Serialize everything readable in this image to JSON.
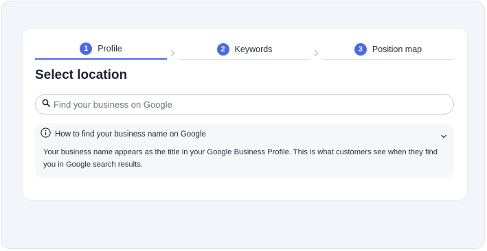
{
  "stepper": {
    "steps": [
      {
        "number": "1",
        "label": "Profile",
        "active": true
      },
      {
        "number": "2",
        "label": "Keywords",
        "active": false
      },
      {
        "number": "3",
        "label": "Position map",
        "active": false
      }
    ]
  },
  "page": {
    "title": "Select location"
  },
  "search": {
    "placeholder": "Find your business on Google",
    "value": ""
  },
  "help": {
    "title": "How to find your business name on Google",
    "body": "Your business name appears as the title in your Google Business Profile. This is what customers see when they find you in Google search results.",
    "expanded": true
  },
  "icons": {
    "step_separator": "chevron-right-icon",
    "search": "search-icon",
    "info": "info-icon",
    "collapse": "chevron-down-icon"
  },
  "colors": {
    "accent": "#4a69e8",
    "background": "#f3f5fa",
    "card": "#ffffff",
    "info_panel": "#f6f7f9"
  }
}
